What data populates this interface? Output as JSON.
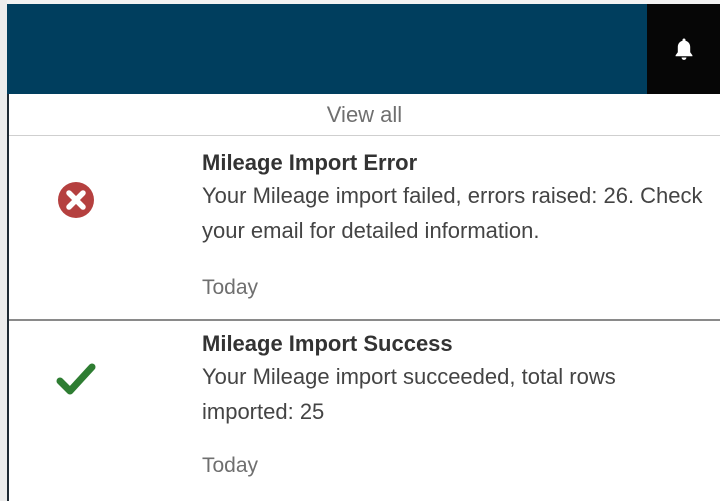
{
  "header": {
    "bell_icon": "bell-icon",
    "bar_color": "#003e5e",
    "bell_bg_color": "#060606"
  },
  "notifications_panel": {
    "view_all_label": "View all",
    "items": [
      {
        "status": "error",
        "icon": "error-circle-x-icon",
        "icon_color": "#b5403f",
        "title": "Mileage Import Error",
        "message": "Your Mileage import failed, errors raised: 26. Check your email for detailed information.",
        "date": "Today"
      },
      {
        "status": "success",
        "icon": "checkmark-icon",
        "icon_color": "#2e7d32",
        "title": "Mileage Import Success",
        "message": "Your Mileage import succeeded, total rows imported: 25",
        "date": "Today"
      }
    ]
  }
}
